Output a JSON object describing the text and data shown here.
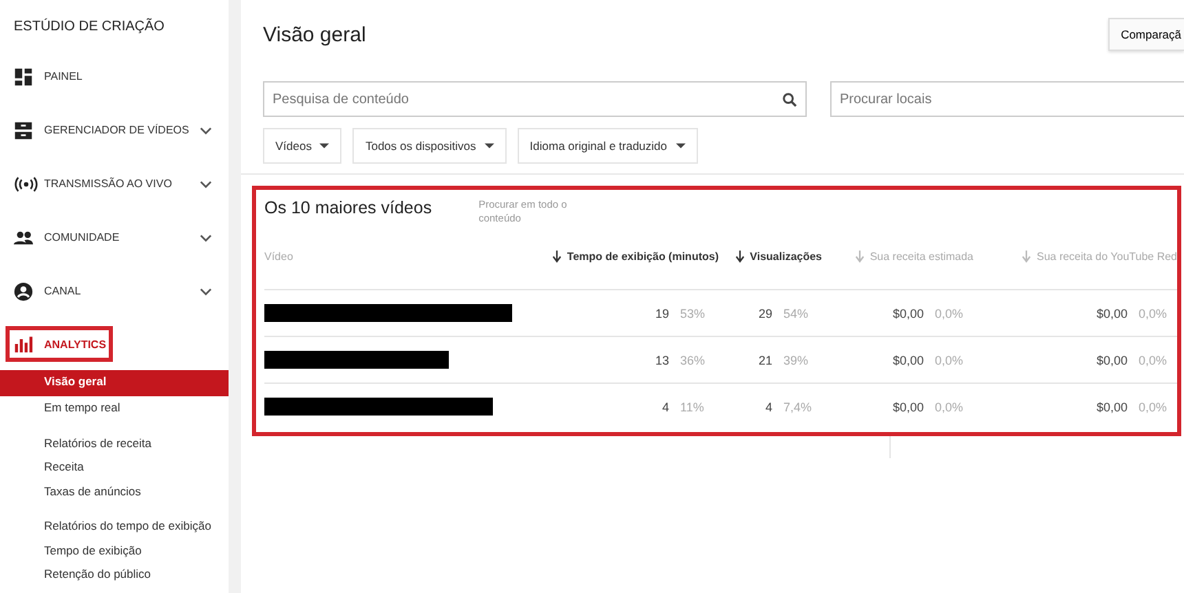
{
  "sidebar": {
    "title": "ESTÚDIO DE CRIAÇÃO",
    "items": [
      {
        "label": "PAINEL",
        "expandable": false,
        "active": false
      },
      {
        "label": "GERENCIADOR DE VÍDEOS",
        "expandable": true,
        "active": false
      },
      {
        "label": "TRANSMISSÃO AO VIVO",
        "expandable": true,
        "active": false
      },
      {
        "label": "COMUNIDADE",
        "expandable": true,
        "active": false
      },
      {
        "label": "CANAL",
        "expandable": true,
        "active": false
      },
      {
        "label": "ANALYTICS",
        "expandable": false,
        "active": true
      }
    ],
    "subgroups": [
      [
        {
          "label": "Visão geral",
          "selected": true
        },
        {
          "label": "Em tempo real",
          "selected": false
        }
      ],
      [
        {
          "label": "Relatórios de receita",
          "selected": false
        },
        {
          "label": "Receita",
          "selected": false
        },
        {
          "label": "Taxas de anúncios",
          "selected": false
        }
      ],
      [
        {
          "label": "Relatórios do tempo de exibição",
          "selected": false
        },
        {
          "label": "Tempo de exibição",
          "selected": false
        },
        {
          "label": "Retenção do público",
          "selected": false
        }
      ]
    ]
  },
  "page": {
    "title": "Visão geral",
    "compare_button": "Comparaçã"
  },
  "search": {
    "placeholder": "Pesquisa de conteúdo"
  },
  "location_search": {
    "placeholder": "Procurar locais"
  },
  "filters": [
    "Vídeos",
    "Todos os dispositivos",
    "Idioma original e traduzido"
  ],
  "top_videos": {
    "title": "Os 10 maiores vídeos",
    "search_link": "Procurar em todo o conteúdo",
    "columns": [
      {
        "label": "Vídeo",
        "active": false,
        "sortable": false
      },
      {
        "label": "Tempo de exibição (minutos)",
        "active": true,
        "sortable": true
      },
      {
        "label": "Visualizações",
        "active": true,
        "sortable": true
      },
      {
        "label": "Sua receita estimada",
        "active": false,
        "sortable": true
      },
      {
        "label": "Sua receita do YouTube Red",
        "active": false,
        "sortable": true
      }
    ],
    "rows": [
      {
        "cells": [
          {
            "kind": "redacted"
          },
          {
            "kind": "metric",
            "value": "19",
            "share": "53%"
          },
          {
            "kind": "metric",
            "value": "29",
            "share": "54%"
          },
          {
            "kind": "metric",
            "value": "$0,00",
            "share": "0,0%"
          },
          {
            "kind": "metric",
            "value": "$0,00",
            "share": "0,0%"
          }
        ]
      },
      {
        "cells": [
          {
            "kind": "redacted"
          },
          {
            "kind": "metric",
            "value": "13",
            "share": "36%"
          },
          {
            "kind": "metric",
            "value": "21",
            "share": "39%"
          },
          {
            "kind": "metric",
            "value": "$0,00",
            "share": "0,0%"
          },
          {
            "kind": "metric",
            "value": "$0,00",
            "share": "0,0%"
          }
        ]
      },
      {
        "cells": [
          {
            "kind": "redacted"
          },
          {
            "kind": "metric",
            "value": "4",
            "share": "11%"
          },
          {
            "kind": "metric",
            "value": "4",
            "share": "7,4%"
          },
          {
            "kind": "metric",
            "value": "$0,00",
            "share": "0,0%"
          },
          {
            "kind": "metric",
            "value": "$0,00",
            "share": "0,0%"
          }
        ]
      }
    ]
  }
}
